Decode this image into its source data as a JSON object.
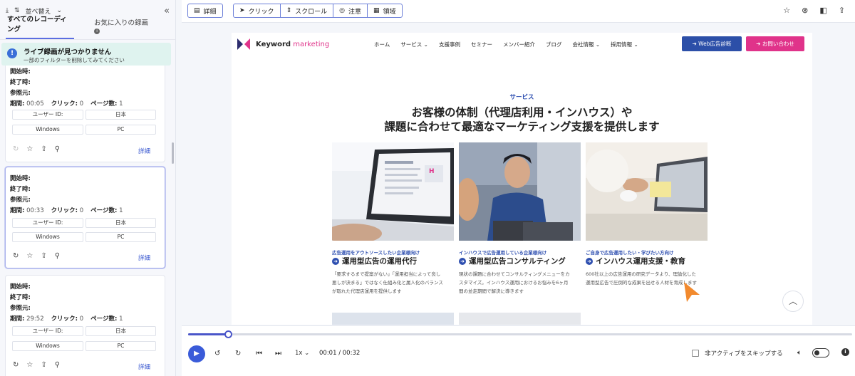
{
  "sidebar": {
    "sort_label": "並べ替え",
    "tabs": [
      {
        "label": "すべてのレコーディング",
        "active": true
      },
      {
        "label": "お気に入りの録画",
        "active": false
      }
    ],
    "banner": {
      "title": "ライブ録画が見つかりません",
      "subtitle": "一部のフィルターを削除してみてください"
    },
    "field_labels": {
      "start": "開始時:",
      "end": "終了時:",
      "referrer": "参照元:",
      "duration": "期間:",
      "clicks": "クリック:",
      "pages": "ページ数:"
    },
    "detail_label": "詳細",
    "recordings": [
      {
        "duration": "00:05",
        "clicks": "0",
        "pages": "1",
        "user_id": "ユーザー ID:",
        "country": "日本",
        "os": "Windows",
        "device": "PC"
      },
      {
        "duration": "00:33",
        "clicks": "0",
        "pages": "1",
        "user_id": "ユーザー ID:",
        "country": "日本",
        "os": "Windows",
        "device": "PC"
      },
      {
        "duration": "29:52",
        "clicks": "0",
        "pages": "1",
        "user_id": "ユーザー ID:",
        "country": "日本",
        "os": "Windows",
        "device": "PC"
      }
    ]
  },
  "toolbar": {
    "detail": "詳細",
    "click": "クリック",
    "scroll": "スクロール",
    "attention": "注意",
    "area": "領域"
  },
  "site": {
    "logo_text_1": "Keyword",
    "logo_text_2": "marketing",
    "nav": [
      "ホーム",
      "サービス",
      "支援事例",
      "セミナー",
      "メンバー紹介",
      "ブログ",
      "会社情報",
      "採用情報"
    ],
    "btn_web": "Web広告診断",
    "btn_contact": "お問い合わせ",
    "section_label": "サービス",
    "headline_1": "お客様の体制（代理店利用・インハウス）や",
    "headline_2": "課題に合わせて最適なマーケティング支援を提供します",
    "services": [
      {
        "tag": "広告運用をアウトソースしたい企業様向け",
        "title": "運用型広告の運用代行",
        "desc_1": "「要求するまで提案がない」「運用担当によって良し",
        "desc_2": "悪しが決まる」ではなく仕組み化と属人化のバランス",
        "desc_3": "が取れた代理店運用を提供します"
      },
      {
        "tag": "インハウスで広告運用している企業様向け",
        "title": "運用型広告コンサルティング",
        "desc_1": "現状の課題に合わせてコンサルティングメニューをカ",
        "desc_2": "スタマイズ。インハウス運用におけるお悩みを6ヶ月",
        "desc_3": "間の並走期間で解決に導きます"
      },
      {
        "tag": "ご自身で広告運用したい・学びたい方向け",
        "title": "インハウス運用支援・教育",
        "desc_1": "600社以上の広告運用の研究データより、理論化した",
        "desc_2": "運用型広告で圧倒的な成果を出せる人材を育成します",
        "desc_3": ""
      }
    ],
    "laptop_screen_text": "H"
  },
  "player": {
    "progress": 0.06,
    "speed": "1x",
    "time": "00:01 / 00:32",
    "skip_label": "非アクティブをスキップする"
  },
  "colors": {
    "accent": "#3a5bd9",
    "brand_pink": "#e0338a",
    "brand_blue": "#2c4fa8",
    "cursor": "#f28a2e"
  }
}
